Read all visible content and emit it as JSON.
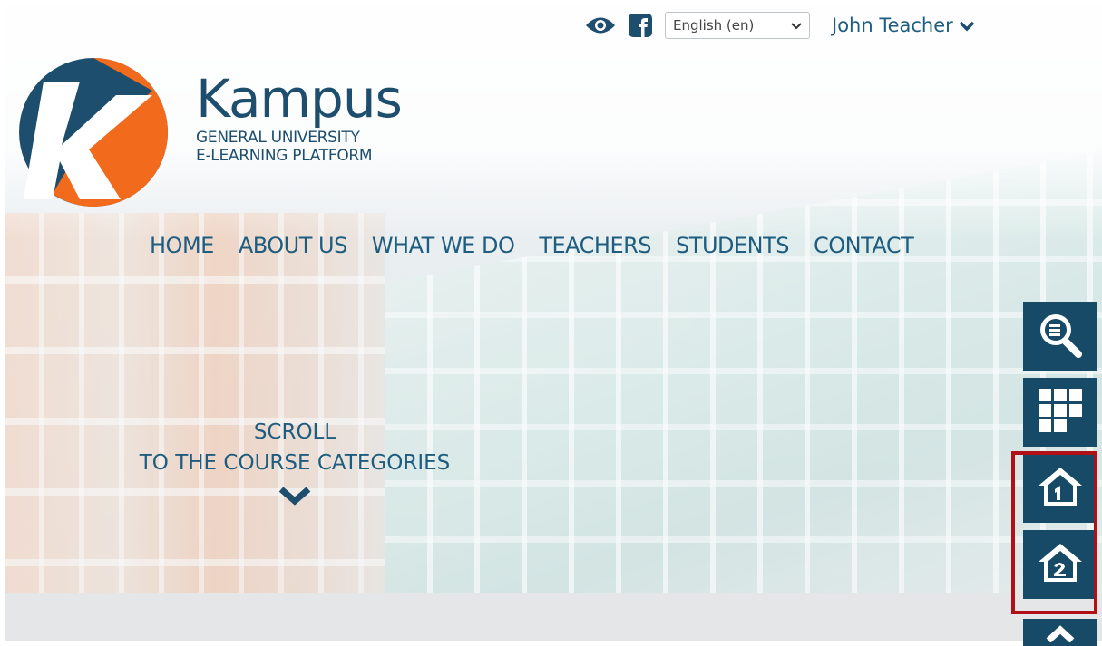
{
  "colors": {
    "brand_blue": "#1e4e6e",
    "nav_blue": "#1e5d80",
    "brand_orange": "#f26a1b",
    "dock_blue": "#164a66",
    "highlight_red": "#b11116"
  },
  "topbar": {
    "accessibility_icon": "eye-icon",
    "social_icon": "facebook-icon",
    "language_selected": "English (en)",
    "user_name": "John Teacher"
  },
  "logo": {
    "title": "Kampus",
    "subtitle_line1": "GENERAL UNIVERSITY",
    "subtitle_line2": "E-LEARNING PLATFORM"
  },
  "nav": {
    "items": [
      "HOME",
      "ABOUT US",
      "WHAT WE DO",
      "TEACHERS",
      "STUDENTS",
      "CONTACT"
    ]
  },
  "scroll_prompt": {
    "line1": "SCROLL",
    "line2": "TO THE COURSE CATEGORIES"
  },
  "dock": {
    "buttons": [
      "search-courses-icon",
      "grid-apps-icon",
      "home-1-icon",
      "home-2-icon"
    ]
  }
}
